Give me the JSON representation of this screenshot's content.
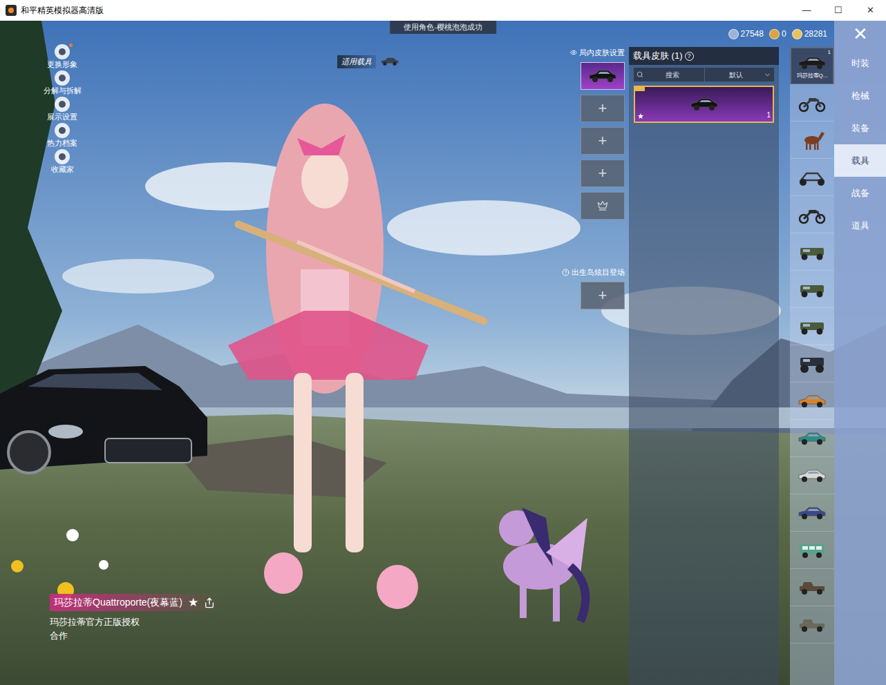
{
  "window": {
    "title": "和平精英模拟器高清版",
    "controls": [
      "—",
      "☐",
      "✕"
    ]
  },
  "toast": "使用角色-樱桃泡泡成功",
  "side_menu": [
    {
      "label": "更换形象",
      "badge": true
    },
    {
      "label": "分解与拆解",
      "badge": false
    },
    {
      "label": "展示设置",
      "badge": false
    },
    {
      "label": "热力档案",
      "badge": false
    },
    {
      "label": "收藏家",
      "badge": false
    }
  ],
  "vehicle_tag": "适用载具",
  "currencies": [
    {
      "value": "27548",
      "color": "#9fb2d8"
    },
    {
      "value": "0",
      "color": "#d9a441"
    },
    {
      "value": "28281",
      "color": "#e8c25a"
    }
  ],
  "close": "✕",
  "skin_slots": {
    "title": "局内皮肤设置",
    "slots": [
      {
        "kind": "skin",
        "selected": true,
        "label": ""
      },
      {
        "kind": "empty",
        "selected": false,
        "label": "+"
      },
      {
        "kind": "empty",
        "selected": false,
        "label": "+"
      },
      {
        "kind": "empty",
        "selected": false,
        "label": "+"
      },
      {
        "kind": "crown",
        "selected": false,
        "label": ""
      }
    ]
  },
  "entrance": {
    "title": "出生岛炫目登场",
    "slot_label": "+"
  },
  "skin_panel": {
    "title": "载具皮肤 (1)",
    "help": "?",
    "search": "搜索",
    "sort": "默认",
    "items": [
      {
        "count": "1",
        "mark": "★",
        "selected": true
      }
    ]
  },
  "vehicles": [
    {
      "kind": "car",
      "label": "玛莎拉蒂Q...",
      "count": "1",
      "selected": true,
      "color": "#1a1a1a"
    },
    {
      "kind": "moto",
      "label": "",
      "count": "",
      "selected": false,
      "color": "#3a3a3a"
    },
    {
      "kind": "horse",
      "label": "",
      "count": "",
      "selected": false,
      "color": "#7a3e22"
    },
    {
      "kind": "buggy",
      "label": "",
      "count": "",
      "selected": false,
      "color": "#3a3a3a"
    },
    {
      "kind": "moto",
      "label": "",
      "count": "",
      "selected": false,
      "color": "#2a2a2a"
    },
    {
      "kind": "jeep",
      "label": "",
      "count": "",
      "selected": false,
      "color": "#4a5a3a"
    },
    {
      "kind": "jeep",
      "label": "",
      "count": "",
      "selected": false,
      "color": "#4a5a3a"
    },
    {
      "kind": "jeep",
      "label": "",
      "count": "",
      "selected": false,
      "color": "#4a5a3a"
    },
    {
      "kind": "truck",
      "label": "",
      "count": "",
      "selected": false,
      "color": "#2b2f3a"
    },
    {
      "kind": "car",
      "label": "",
      "count": "",
      "selected": false,
      "color": "#d9822b"
    },
    {
      "kind": "car",
      "label": "",
      "count": "",
      "selected": false,
      "color": "#2e8b86"
    },
    {
      "kind": "car",
      "label": "",
      "count": "",
      "selected": false,
      "color": "#d8d8d8"
    },
    {
      "kind": "car",
      "label": "",
      "count": "",
      "selected": false,
      "color": "#3a4a8a"
    },
    {
      "kind": "van",
      "label": "",
      "count": "",
      "selected": false,
      "color": "#5aa38a"
    },
    {
      "kind": "pickup",
      "label": "",
      "count": "",
      "selected": false,
      "color": "#5a4a3a"
    },
    {
      "kind": "pickup",
      "label": "",
      "count": "",
      "selected": false,
      "color": "#6a6a5a"
    }
  ],
  "tabs": [
    {
      "label": "时装",
      "selected": false
    },
    {
      "label": "枪械",
      "selected": false
    },
    {
      "label": "装备",
      "selected": false
    },
    {
      "label": "载具",
      "selected": true
    },
    {
      "label": "战备",
      "selected": false
    },
    {
      "label": "道具",
      "selected": false
    }
  ],
  "item": {
    "name": "玛莎拉蒂Quattroporte(夜幕蓝)",
    "star": "★",
    "license": "玛莎拉蒂官方正版授权",
    "tag": "合作"
  }
}
